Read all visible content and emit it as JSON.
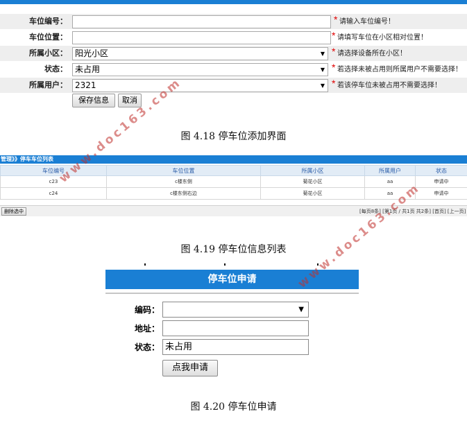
{
  "fig18": {
    "rows": [
      {
        "label": "车位编号：",
        "value": "",
        "hint": "请输入车位编号！"
      },
      {
        "label": "车位位置：",
        "value": "",
        "hint": "请填写车位在小区相对位置！"
      },
      {
        "label": "所属小区：",
        "value": "阳光小区",
        "hint": "请选择设备所在小区！"
      },
      {
        "label": "状态：",
        "value": "未占用",
        "hint": "若选择未被占用则所属用户不需要选择！"
      },
      {
        "label": "所属用户：",
        "value": "2321",
        "hint": "若该停车位未被占用不需要选择！"
      }
    ],
    "star": "*",
    "save_label": "保存信息",
    "cancel_label": "取消",
    "caption": "图 4.18 停车位添加界面"
  },
  "fig19": {
    "header_title": "管理》》停车车位列表",
    "columns": [
      "车位编号",
      "车位位置",
      "所属小区",
      "所属用户",
      "状态"
    ],
    "rows": [
      [
        "c23",
        "c楼东侧",
        "菊花小区",
        "aa",
        "申请中"
      ],
      [
        "c24",
        "c楼东侧右边",
        "菊花小区",
        "aa",
        "申请中"
      ]
    ],
    "delete_label": "删除选中",
    "pager_text": "[每页8条] [第1页 / 共1页 共2条] [首页] [上一页] [下一页]",
    "caption": "图 4.19 停车位信息列表"
  },
  "fig20": {
    "title": "停车位申请",
    "code_label": "编码：",
    "code_value": "",
    "address_label": "地址：",
    "address_value": "",
    "status_label": "状态：",
    "status_value": "未占用",
    "apply_label": "点我申请",
    "caption": "图 4.20 停车位申请"
  },
  "watermark": "www.doc163.com",
  "colors": {
    "accent": "#1a7fd4",
    "required_star": "#e00000",
    "watermark": "#c0302c"
  }
}
